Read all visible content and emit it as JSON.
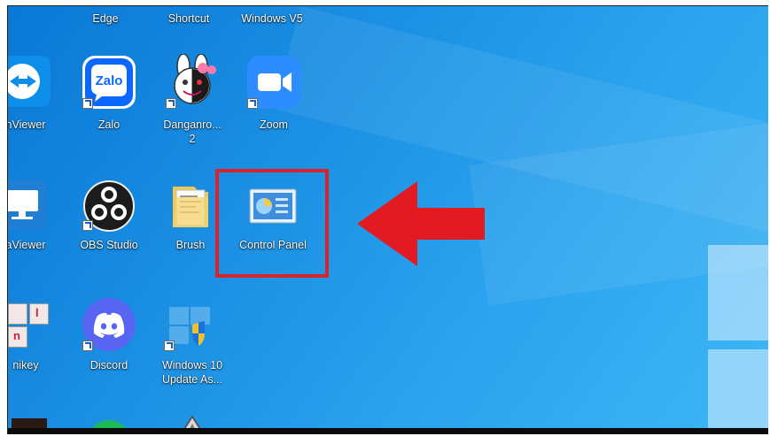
{
  "desktop": {
    "top_row": [
      "Edge",
      "Shortcut",
      "Windows V5"
    ],
    "row2": [
      "nViewer",
      "Zalo",
      "Danganro...",
      "2",
      "Zoom"
    ],
    "zalo_logo_text": "Zalo",
    "row3": [
      "aViewer",
      "OBS Studio",
      "Brush",
      "Control Panel"
    ],
    "row4": [
      "nikey",
      "Discord",
      "Windows 10",
      "Update As..."
    ],
    "unikey_letters": [
      "l",
      "n"
    ]
  },
  "annotation": {
    "highlight_color": "#d8232a",
    "arrow_color": "#e21b22",
    "target": "Control Panel"
  },
  "colors": {
    "wallpaper": "#1a8fe3",
    "zoom": "#2d8cff",
    "discord": "#5865f2"
  }
}
